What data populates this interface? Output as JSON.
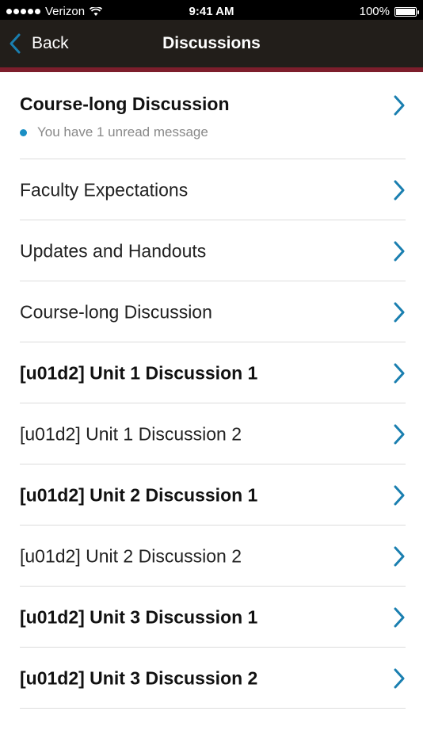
{
  "status_bar": {
    "carrier": "Verizon",
    "time": "9:41 AM",
    "battery": "100%"
  },
  "nav": {
    "back_label": "Back",
    "title": "Discussions"
  },
  "list": {
    "items": [
      {
        "label": "Course-long Discussion",
        "bold": true,
        "subtitle": "You have 1 unread message"
      },
      {
        "label": "Faculty Expectations",
        "bold": false
      },
      {
        "label": "Updates and Handouts",
        "bold": false
      },
      {
        "label": "Course-long Discussion",
        "bold": false
      },
      {
        "label": "[u01d2] Unit 1 Discussion 1",
        "bold": true
      },
      {
        "label": "[u01d2] Unit 1 Discussion 2",
        "bold": false
      },
      {
        "label": "[u01d2] Unit 2 Discussion 1",
        "bold": true
      },
      {
        "label": "[u01d2] Unit 2 Discussion 2",
        "bold": false
      },
      {
        "label": "[u01d2] Unit 3 Discussion 1",
        "bold": true
      },
      {
        "label": "[u01d2] Unit 3 Discussion 2",
        "bold": true
      }
    ]
  },
  "colors": {
    "accent": "#1a7fb0",
    "nav_background": "#221e1a",
    "nav_border": "#7d1e2c",
    "unread_dot": "#1a8fc4"
  },
  "icons": {
    "back": "chevron-left-icon",
    "row": "chevron-right-icon",
    "signal": "signal-icon",
    "wifi": "wifi-icon",
    "battery": "battery-icon"
  }
}
